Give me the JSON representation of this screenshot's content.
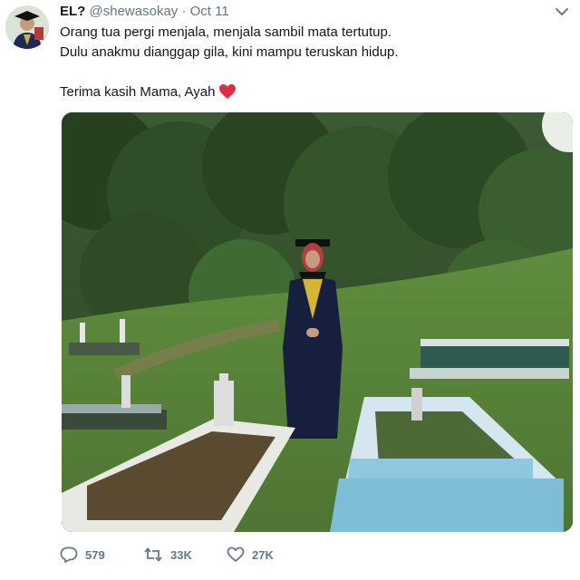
{
  "tweet": {
    "display_name": "EL?",
    "handle": "@shewasokay",
    "separator": "·",
    "date": "Oct 11",
    "lines": [
      "Orang tua pergi menjala, menjala sambil mata tertutup.",
      "Dulu anakmu dianggap gila, kini mampu teruskan hidup.",
      "Terima kasih Mama, Ayah"
    ],
    "emoji_icon": "red-heart-emoji",
    "counts": {
      "replies": "579",
      "retweets": "33K",
      "likes": "27K"
    }
  },
  "icons": {
    "reply": "reply-icon",
    "retweet": "retweet-icon",
    "like": "like-icon",
    "more": "chevron-down-icon"
  },
  "colors": {
    "text": "#14171a",
    "secondary": "#657786",
    "heart": "#e0245e"
  }
}
